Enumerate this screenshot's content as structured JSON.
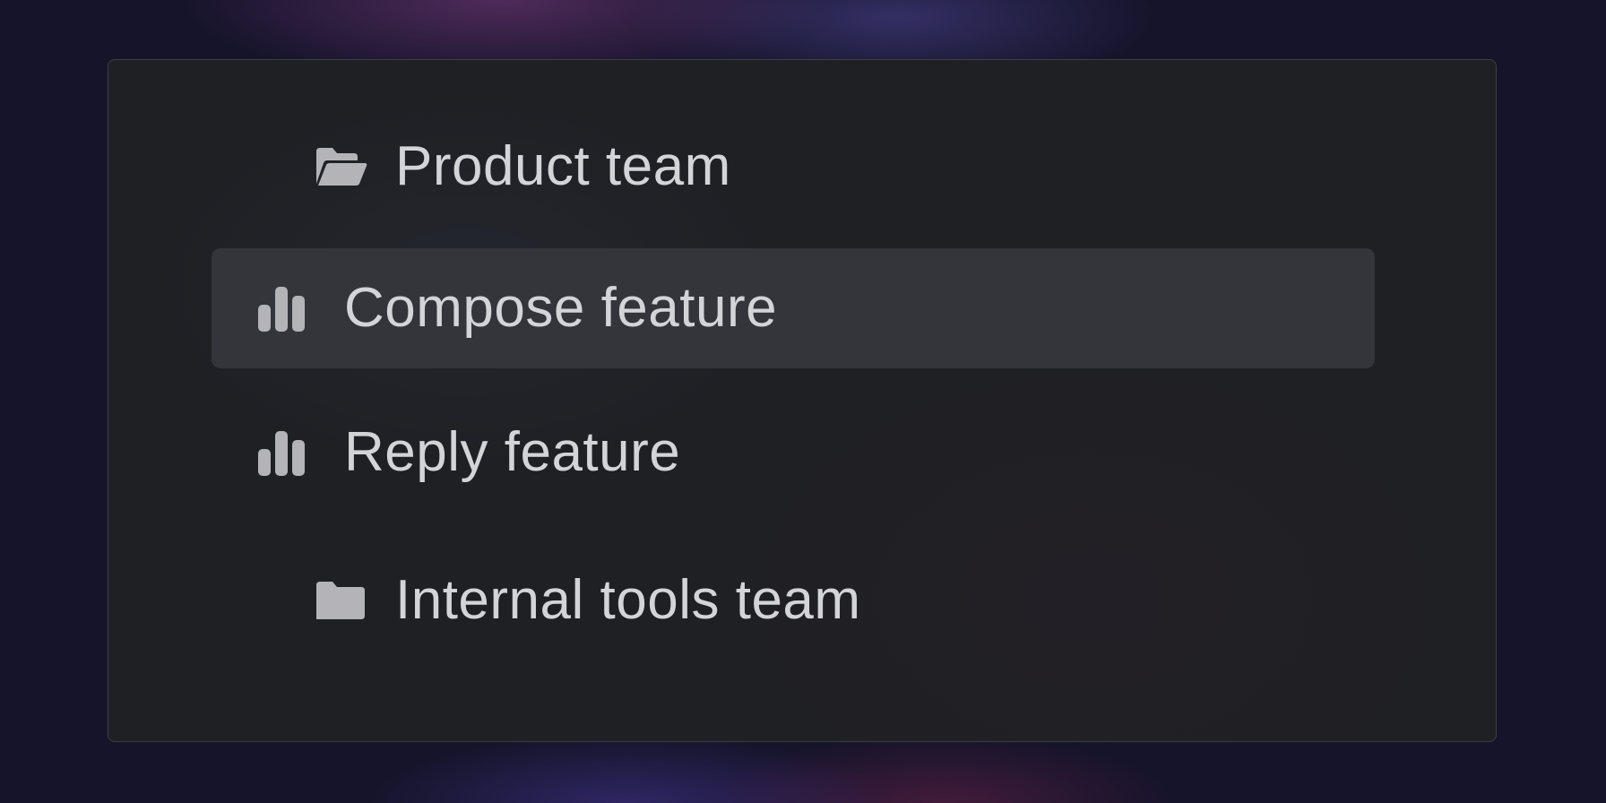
{
  "tree": {
    "groups": [
      {
        "label": "Product team",
        "icon": "folder-open-icon",
        "expanded": true,
        "items": [
          {
            "label": "Compose feature",
            "icon": "bar-chart-icon",
            "selected": true
          },
          {
            "label": "Reply feature",
            "icon": "bar-chart-icon",
            "selected": false
          }
        ]
      },
      {
        "label": "Internal tools team",
        "icon": "folder-icon",
        "expanded": false,
        "items": []
      }
    ]
  },
  "colors": {
    "panel_background": "#1f2024",
    "panel_border": "#3d3e45",
    "selected_background": "#33353b",
    "text": "#d3d4d8",
    "icon": "#b4b4b8"
  }
}
